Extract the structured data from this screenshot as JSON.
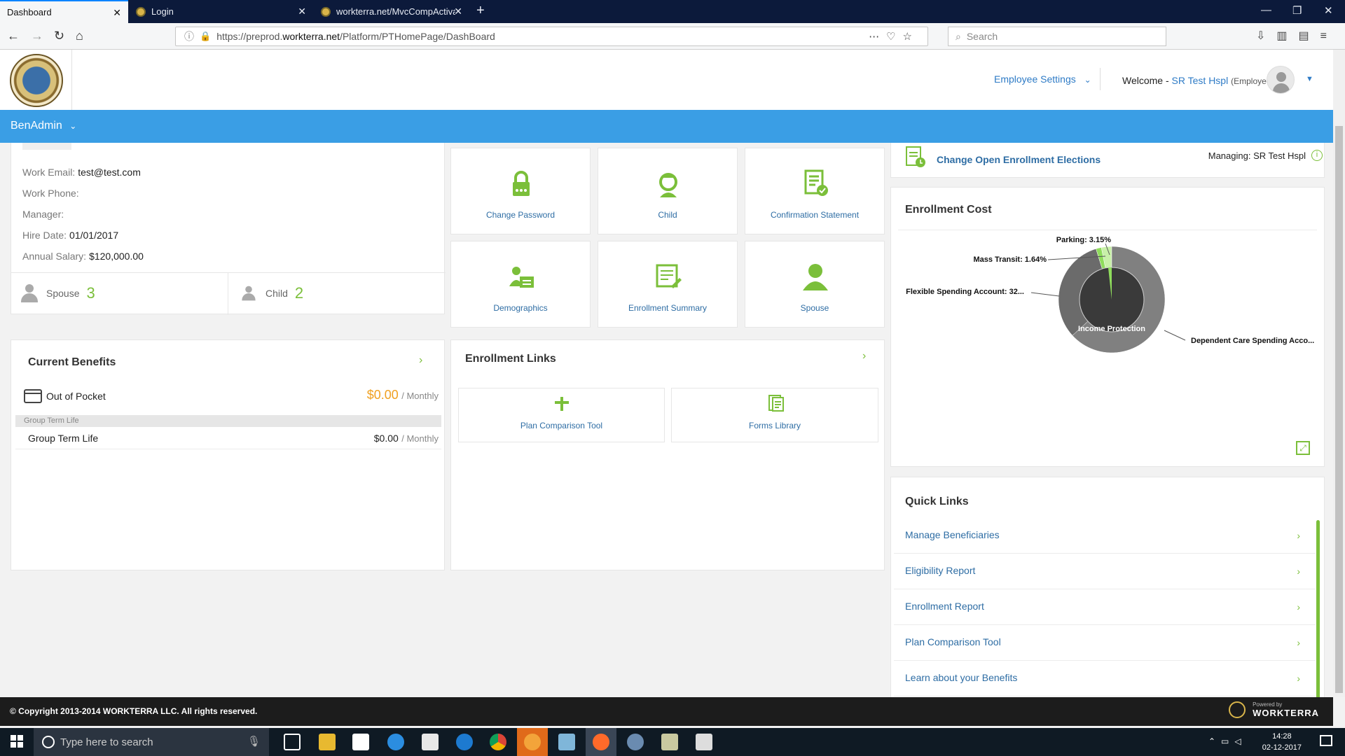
{
  "browser": {
    "tabs": [
      {
        "title": "Dashboard"
      },
      {
        "title": "Login"
      },
      {
        "title": "workterra.net/MvcCompActiva"
      }
    ],
    "url_prefix": "https://preprod.",
    "url_domain": "workterra.net",
    "url_path": "/Platform/PTHomePage/DashBoard",
    "search_placeholder": "Search"
  },
  "header": {
    "employee_settings": "Employee Settings",
    "welcome_label": "Welcome -",
    "user_name": "SR Test Hspl",
    "user_role": "(Employee)"
  },
  "nav": {
    "menu": "BenAdmin"
  },
  "profile": {
    "work_email_label": "Work Email:",
    "work_email": "test@test.com",
    "work_phone_label": "Work Phone:",
    "work_phone": "",
    "manager_label": "Manager:",
    "manager": "",
    "hire_date_label": "Hire Date:",
    "hire_date": "01/01/2017",
    "salary_label": "Annual Salary:",
    "salary": "$120,000.00",
    "spouse_label": "Spouse",
    "spouse_count": "3",
    "child_label": "Child",
    "child_count": "2"
  },
  "tiles": [
    {
      "label": "Change Password",
      "icon": "padlock-icon"
    },
    {
      "label": "Child",
      "icon": "child-icon"
    },
    {
      "label": "Confirmation Statement",
      "icon": "certificate-icon"
    },
    {
      "label": "Demographics",
      "icon": "id-card-icon"
    },
    {
      "label": "Enrollment Summary",
      "icon": "summary-icon"
    },
    {
      "label": "Spouse",
      "icon": "person-icon"
    }
  ],
  "current_benefits": {
    "title": "Current Benefits",
    "out_of_pocket_label": "Out of Pocket",
    "out_of_pocket_amount": "$0.00",
    "per": "/ Monthly",
    "group_header": "Group Term Life",
    "items": [
      {
        "name": "Group Term Life",
        "amount": "$0.00",
        "per": "/ Monthly"
      }
    ]
  },
  "enrollment_links": {
    "title": "Enrollment Links",
    "items": [
      {
        "label": "Plan Comparison Tool"
      },
      {
        "label": "Forms Library"
      }
    ]
  },
  "open_enrollment": {
    "link": "Change Open Enrollment Elections",
    "managing_label": "Managing:",
    "managing_name": "SR Test Hspl"
  },
  "enrollment_cost": {
    "title": "Enrollment Cost"
  },
  "chart_data": {
    "type": "pie",
    "title": "Enrollment Cost",
    "slice_labels": [
      "Parking: 3.15%",
      "Mass Transit: 1.64%",
      "Flexible Spending Account: 32...",
      "Dependent Care Spending Acco...",
      "Income Protection"
    ],
    "values": [
      3.15,
      1.64,
      32,
      63.21
    ],
    "colors": [
      "#c8f0a8",
      "#8fdc5c",
      "#6b6b6b",
      "#808080",
      "#3a3a3a"
    ]
  },
  "quick_links": {
    "title": "Quick Links",
    "items": [
      {
        "label": "Manage Beneficiaries"
      },
      {
        "label": "Eligibility Report"
      },
      {
        "label": "Enrollment Report"
      },
      {
        "label": "Plan Comparison Tool"
      },
      {
        "label": "Learn about your Benefits"
      }
    ]
  },
  "footer": {
    "copyright": "© Copyright 2013-2014 WORKTERRA LLC. All rights reserved.",
    "powered_by": "Powered by",
    "brand": "WORKTERRA"
  },
  "taskbar": {
    "search_placeholder": "Type here to search",
    "time": "14:28",
    "date": "02-12-2017"
  }
}
